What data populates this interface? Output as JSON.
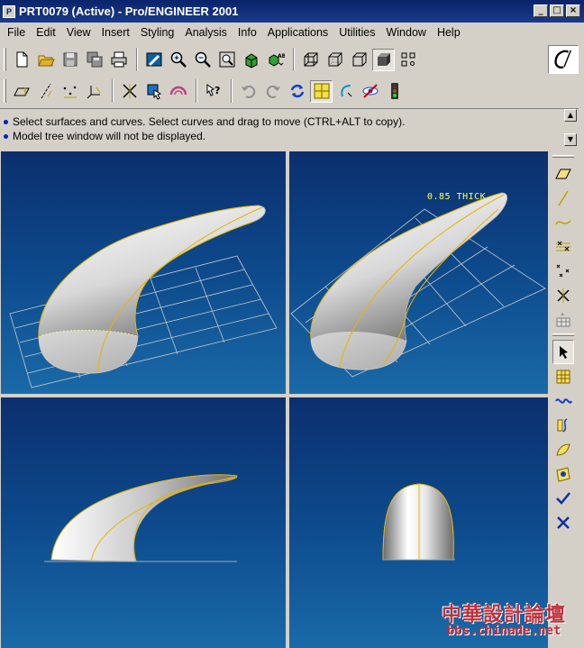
{
  "window": {
    "title": "PRT0079 (Active) - Pro/ENGINEER 2001",
    "icon": "proe-app-icon",
    "controls": [
      "_",
      "□",
      "×"
    ]
  },
  "menu": [
    {
      "label": "File"
    },
    {
      "label": "Edit"
    },
    {
      "label": "View"
    },
    {
      "label": "Insert"
    },
    {
      "label": "Styling"
    },
    {
      "label": "Analysis"
    },
    {
      "label": "Info"
    },
    {
      "label": "Applications"
    },
    {
      "label": "Utilities"
    },
    {
      "label": "Window"
    },
    {
      "label": "Help"
    }
  ],
  "toolbar1": [
    "new-icon",
    "open-icon",
    "save-icon",
    "save-copy-icon",
    "print-icon",
    "repaint-icon",
    "zoom-in-icon",
    "zoom-out-icon",
    "refit-icon",
    "orient-icon",
    "saved-views-icon",
    "wireframe-icon",
    "hidden-line-icon",
    "no-hidden-icon",
    "shading-icon",
    "datum-display-icon"
  ],
  "toolbar2": [
    "datum-planes-icon",
    "datum-axes-icon",
    "datum-points-icon",
    "coord-sys-icon",
    "spin-center-icon",
    "select-box-icon",
    "style-icon",
    "whats-this-icon",
    "undo-icon",
    "redo-icon",
    "regenerate-icon",
    "grid-icon",
    "curve-icon",
    "hide-icon",
    "traffic-light-icon"
  ],
  "logo": {
    "name": "ptc-logo"
  },
  "messages": [
    "Select surfaces and curves.  Select curves and drag to move (CTRL+ALT to copy).",
    "Model tree window will not be displayed."
  ],
  "viewports": {
    "annotation": "0.85 THICK"
  },
  "right_toolbar": [
    "plane-icon",
    "line-icon",
    "curve-icon",
    "grid-points-icon",
    "points-icon",
    "delete-points-icon",
    "mesh-icon",
    "select-arrow-icon",
    "grid-select-icon",
    "wave-curve-icon",
    "curve-edit-icon",
    "surface-icon",
    "trim-icon",
    "accept-icon",
    "cancel-icon"
  ],
  "watermark": {
    "cn": "中華設計論壇",
    "url": "bbs.chinade.net"
  },
  "colors": {
    "title_bar": "#0a246a",
    "viewport_bg": "#0d4a8c",
    "curve": "#e8b400",
    "annotation": "#ffff60"
  }
}
